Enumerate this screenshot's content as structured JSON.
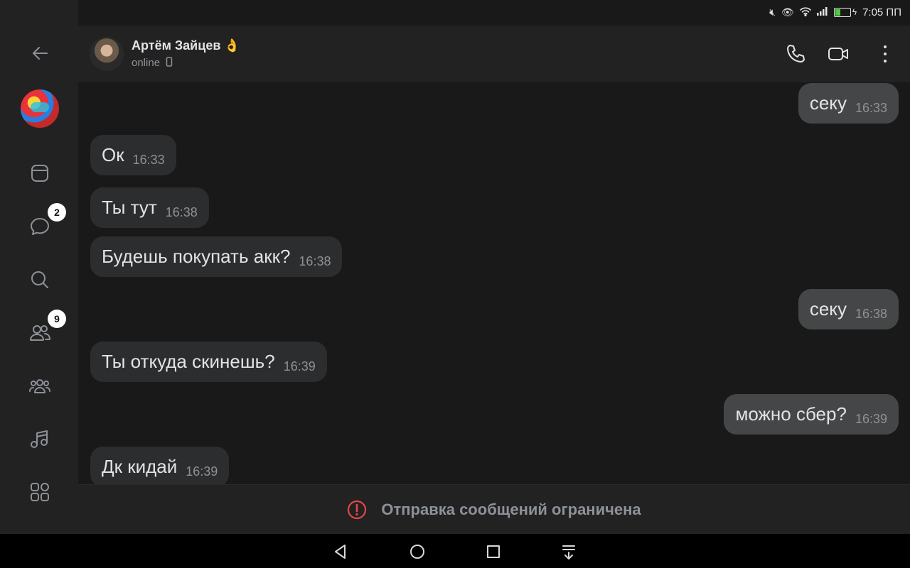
{
  "status_bar": {
    "icons": [
      "mute-icon",
      "eye-icon",
      "wifi-icon",
      "signal-icon"
    ],
    "battery_level": "35",
    "time": "7:05 ПП"
  },
  "rail": {
    "items": [
      {
        "name": "back",
        "icon": "arrow-left-icon"
      },
      {
        "name": "profile",
        "icon": "app-avatar"
      },
      {
        "name": "feed",
        "icon": "window-icon"
      },
      {
        "name": "messages",
        "icon": "chat-bubble-icon",
        "badge": "2"
      },
      {
        "name": "search",
        "icon": "search-icon"
      },
      {
        "name": "friends",
        "icon": "friends-icon",
        "badge": "9"
      },
      {
        "name": "communities",
        "icon": "group-icon"
      },
      {
        "name": "music",
        "icon": "music-note-icon"
      },
      {
        "name": "services",
        "icon": "grid-icon"
      }
    ]
  },
  "header": {
    "name": "Артём Зайцев 👌",
    "status": "online",
    "status_icon": "mobile-icon",
    "actions": [
      "phone-icon",
      "video-call-icon",
      "more-vertical-icon"
    ]
  },
  "messages": [
    {
      "dir": "out",
      "text": "секу",
      "time": "16:33"
    },
    {
      "dir": "in",
      "text": "Ок",
      "time": "16:33"
    },
    {
      "dir": "in",
      "text": "Ты тут",
      "time": "16:38"
    },
    {
      "dir": "in",
      "text": "Будешь покупать акк?",
      "time": "16:38"
    },
    {
      "dir": "out",
      "text": "секу",
      "time": "16:38"
    },
    {
      "dir": "in",
      "text": "Ты откуда скинешь?",
      "time": "16:39"
    },
    {
      "dir": "out",
      "text": "можно сбер?",
      "time": "16:39"
    },
    {
      "dir": "in",
      "text": "Дк кидай",
      "time": "16:39"
    }
  ],
  "composer": {
    "notice": "Отправка сообщений ограничена",
    "icon": "warning-circle-icon",
    "accent": "#e64646"
  },
  "nav": [
    "back-triangle-icon",
    "home-circle-icon",
    "recents-square-icon",
    "notifications-down-icon"
  ]
}
